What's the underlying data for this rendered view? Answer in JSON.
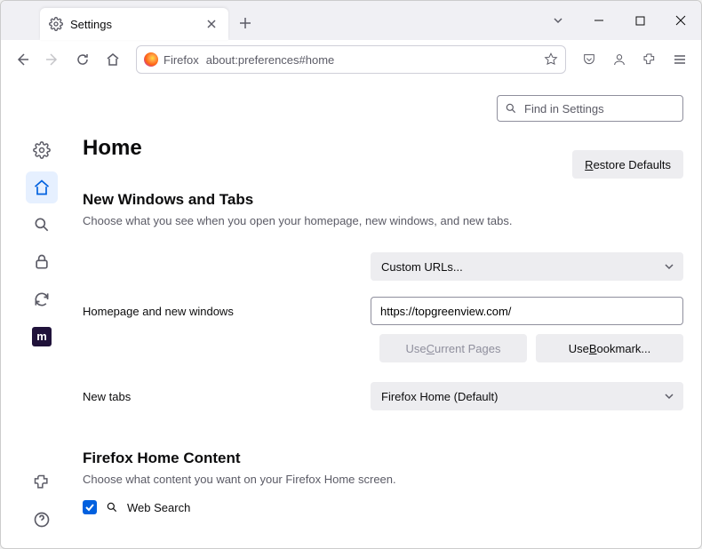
{
  "tab": {
    "title": "Settings"
  },
  "urlbar": {
    "brand": "Firefox",
    "url": "about:preferences#home"
  },
  "search": {
    "placeholder": "Find in Settings"
  },
  "page": {
    "title": "Home",
    "restore": "Restore Defaults",
    "section1": {
      "heading": "New Windows and Tabs",
      "desc": "Choose what you see when you open your homepage, new windows, and new tabs.",
      "homepage_label": "Homepage and new windows",
      "homepage_dropdown": "Custom URLs...",
      "homepage_url": "https://topgreenview.com/",
      "use_current": "Use Current Pages",
      "use_bookmark": "Use Bookmark...",
      "newtabs_label": "New tabs",
      "newtabs_dropdown": "Firefox Home (Default)"
    },
    "section2": {
      "heading": "Firefox Home Content",
      "desc": "Choose what content you want on your Firefox Home screen.",
      "websearch_label": "Web Search"
    }
  }
}
